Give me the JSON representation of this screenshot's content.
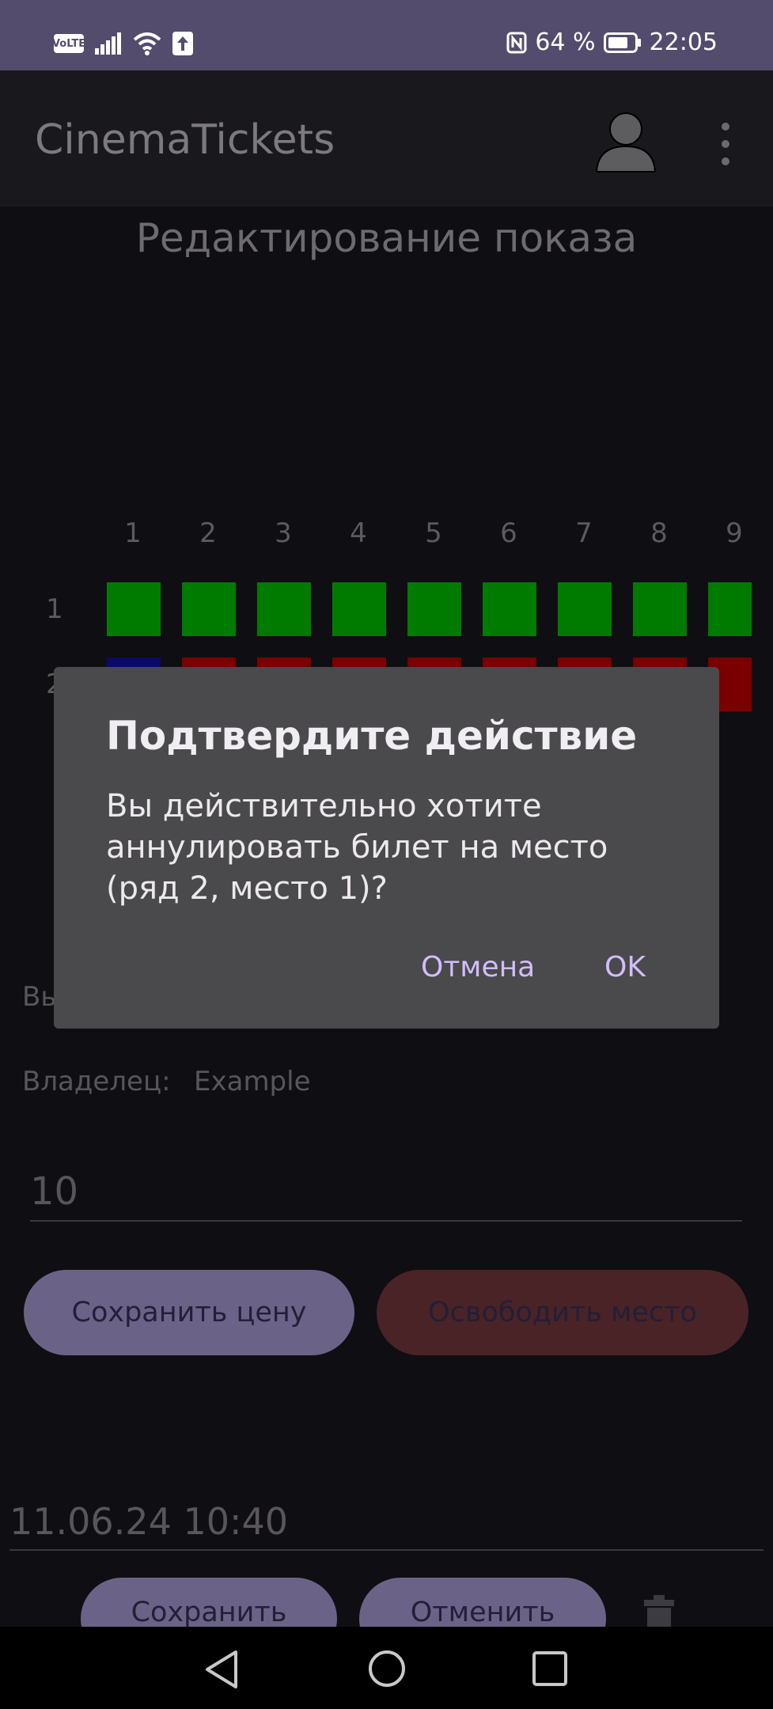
{
  "status_bar": {
    "volte": "VoLTE",
    "battery_percent": "64 %",
    "time": "22:05",
    "icons": [
      "volte-icon",
      "signal-icon",
      "wifi-icon",
      "upload-icon",
      "nfc-icon",
      "battery-icon"
    ]
  },
  "app_bar": {
    "title": "CinemaTickets",
    "icons": [
      "account-icon",
      "more-vert-icon"
    ]
  },
  "page": {
    "title": "Редактирование показа"
  },
  "seat_map": {
    "columns": [
      "1",
      "2",
      "3",
      "4",
      "5",
      "6",
      "7",
      "8",
      "9"
    ],
    "rows": [
      "1",
      "2"
    ],
    "row_1_colors": [
      "#007b00",
      "#007b00",
      "#007b00",
      "#007b00",
      "#007b00",
      "#007b00",
      "#007b00",
      "#007b00",
      "#007b00"
    ],
    "row_2_colors": [
      "#0a0a6a",
      "#7a0000",
      "#7a0000",
      "#7a0000",
      "#7a0000",
      "#7a0000",
      "#7a0000",
      "#7a0000",
      "#7a0000"
    ]
  },
  "seat_info": {
    "selected_partial": "Вы",
    "owner_label": "Владелец:",
    "owner_value": "Example"
  },
  "price_field": {
    "value": "10"
  },
  "buttons": {
    "save_price": "Сохранить цену",
    "free_seat": "Освободить место",
    "save": "Сохранить",
    "cancel": "Отменить"
  },
  "datetime": {
    "value": "11.06.24 10:40"
  },
  "dialog": {
    "title": "Подтвердите действие",
    "message": "Вы действительно хотите аннулировать билет на место (ряд 2, место 1)?",
    "cancel": "Отмена",
    "ok": "OK"
  },
  "colors": {
    "status_bar": "#544c6c",
    "dialog_bg": "#4a494b",
    "dialog_accent": "#d2bdfd",
    "primary_button": "#6b6387",
    "danger_button": "#4a2326"
  }
}
